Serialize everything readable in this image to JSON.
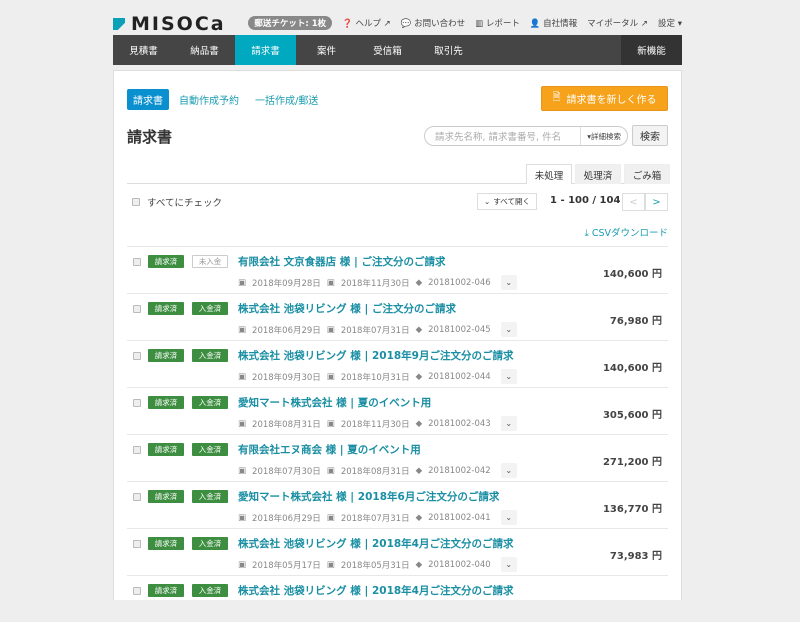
{
  "brand": "MISOCa",
  "top_links": {
    "ticket": "郵送チケット: 1枚",
    "help": "ヘルプ",
    "contact": "お問い合わせ",
    "report": "レポート",
    "company": "自社情報",
    "portal": "マイポータル",
    "settings": "設定"
  },
  "nav": [
    "見積書",
    "納品書",
    "請求書",
    "案件",
    "受信箱",
    "取引先"
  ],
  "nav_new": "新機能",
  "subtabs": [
    "請求書",
    "自動作成予約",
    "一括作成/郵送"
  ],
  "new_button": "請求書を新しく作る",
  "page_title": "請求書",
  "search": {
    "placeholder": "請求先名称, 請求書番号, 件名",
    "advanced": "詳細検索",
    "button": "検索"
  },
  "filter_tabs": [
    "未処理",
    "処理済",
    "ごみ箱"
  ],
  "check_all": "すべてにチェック",
  "open_all": "すべて開く",
  "page_info": "1 - 100 / 104",
  "pager": {
    "prev": "<",
    "next": ">"
  },
  "csv": "CSVダウンロード",
  "rows": [
    {
      "status": "請求済",
      "payment": "未入金",
      "paid": false,
      "title": "有限会社 文京食器店 様 | ご注文分のご請求",
      "issue": "2018年09月28日",
      "due": "2018年11月30日",
      "number": "20181002-046",
      "amount": "140,600 円"
    },
    {
      "status": "請求済",
      "payment": "入金済",
      "paid": true,
      "title": "株式会社 池袋リビング 様 | ご注文分のご請求",
      "issue": "2018年06月29日",
      "due": "2018年07月31日",
      "number": "20181002-045",
      "amount": "76,980 円"
    },
    {
      "status": "請求済",
      "payment": "入金済",
      "paid": true,
      "title": "株式会社 池袋リビング 様 | 2018年9月ご注文分のご請求",
      "issue": "2018年09月30日",
      "due": "2018年10月31日",
      "number": "20181002-044",
      "amount": "140,600 円"
    },
    {
      "status": "請求済",
      "payment": "入金済",
      "paid": true,
      "title": "愛知マート株式会社 様 | 夏のイベント用",
      "issue": "2018年08月31日",
      "due": "2018年11月30日",
      "number": "20181002-043",
      "amount": "305,600 円"
    },
    {
      "status": "請求済",
      "payment": "入金済",
      "paid": true,
      "title": "有限会社エヌ商会 様 | 夏のイベント用",
      "issue": "2018年07月30日",
      "due": "2018年08月31日",
      "number": "20181002-042",
      "amount": "271,200 円"
    },
    {
      "status": "請求済",
      "payment": "入金済",
      "paid": true,
      "title": "愛知マート株式会社 様 | 2018年6月ご注文分のご請求",
      "issue": "2018年06月29日",
      "due": "2018年07月31日",
      "number": "20181002-041",
      "amount": "136,770 円"
    },
    {
      "status": "請求済",
      "payment": "入金済",
      "paid": true,
      "title": "株式会社 池袋リビング 様 | 2018年4月ご注文分のご請求",
      "issue": "2018年05月17日",
      "due": "2018年05月31日",
      "number": "20181002-040",
      "amount": "73,983 円"
    },
    {
      "status": "請求済",
      "payment": "入金済",
      "paid": true,
      "title": "株式会社 池袋リビング 様 | 2018年4月ご注文分のご請求",
      "issue": "",
      "due": "",
      "number": "",
      "amount": ""
    }
  ]
}
